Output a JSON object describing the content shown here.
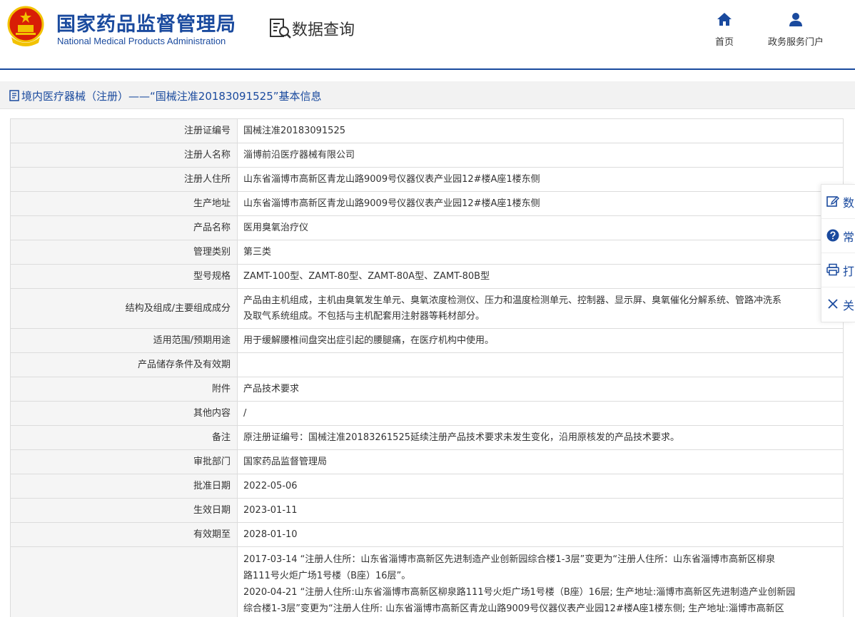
{
  "header": {
    "org_name_cn": "国家药品监督管理局",
    "org_name_en": "National Medical Products Administration",
    "section_title": "数据查询",
    "nav": [
      {
        "label": "首页",
        "icon": "home-icon"
      },
      {
        "label": "政务服务门户",
        "icon": "user-icon"
      }
    ]
  },
  "breadcrumb": "境内医疗器械（注册）——“国械注准20183091525”基本信息",
  "colors": {
    "brand": "#1a4a9e",
    "emblem_red": "#d81e06",
    "emblem_gold": "#f2c200"
  },
  "table": {
    "rows": [
      {
        "label": "注册证编号",
        "value": "国械注准20183091525"
      },
      {
        "label": "注册人名称",
        "value": "淄博前沿医疗器械有限公司"
      },
      {
        "label": "注册人住所",
        "value": "山东省淄博市高新区青龙山路9009号仪器仪表产业园12#楼A座1楼东侧"
      },
      {
        "label": "生产地址",
        "value": "山东省淄博市高新区青龙山路9009号仪器仪表产业园12#楼A座1楼东侧"
      },
      {
        "label": "产品名称",
        "value": "医用臭氧治疗仪"
      },
      {
        "label": "管理类别",
        "value": "第三类"
      },
      {
        "label": "型号规格",
        "value": "ZAMT-100型、ZAMT-80型、ZAMT-80A型、ZAMT-80B型"
      },
      {
        "label": "结构及组成/主要组成成分",
        "value_lines": [
          "产品由主机组成，主机由臭氧发生单元、臭氧浓度检测仪、压力和温度检测单元、控制器、显示屏、臭氧催化分解系统、管路冲洗系",
          "及取气系统组成。不包括与主机配套用注射器等耗材部分。"
        ]
      },
      {
        "label": "适用范围/预期用途",
        "value": "用于缓解腰椎间盘突出症引起的腰腿痛，在医疗机构中使用。"
      },
      {
        "label": "产品储存条件及有效期",
        "value": ""
      },
      {
        "label": "附件",
        "value": "产品技术要求"
      },
      {
        "label": "其他内容",
        "value": "/"
      },
      {
        "label": "备注",
        "value": "原注册证编号：国械注准20183261525延续注册产品技术要求未发生变化，沿用原核发的产品技术要求。"
      },
      {
        "label": "审批部门",
        "value": "国家药品监督管理局"
      },
      {
        "label": "批准日期",
        "value": "2022-05-06"
      },
      {
        "label": "生效日期",
        "value": "2023-01-11"
      },
      {
        "label": "有效期至",
        "value": "2028-01-10"
      }
    ],
    "change_history": [
      "2017-03-14 “注册人住所：山东省淄博市高新区先进制造产业创新园综合楼1-3层”变更为“注册人住所：山东省淄博市高新区柳泉",
      "路111号火炬广场1号楼（B座）16层”。",
      "2020-04-21 “注册人住所:山东省淄博市高新区柳泉路111号火炬广场1号楼（B座）16层; 生产地址:淄博市高新区先进制造产业创新园",
      "综合楼1-3层”变更为“注册人住所: 山东省淄博市高新区青龙山路9009号仪器仪表产业园12#楼A座1楼东侧; 生产地址:淄博市高新区"
    ]
  },
  "float_toolbar": [
    {
      "label": "数",
      "icon": "edit-icon"
    },
    {
      "label": "常",
      "icon": "help-icon"
    },
    {
      "label": "打",
      "icon": "print-icon"
    },
    {
      "label": "关",
      "icon": "close-icon"
    }
  ]
}
